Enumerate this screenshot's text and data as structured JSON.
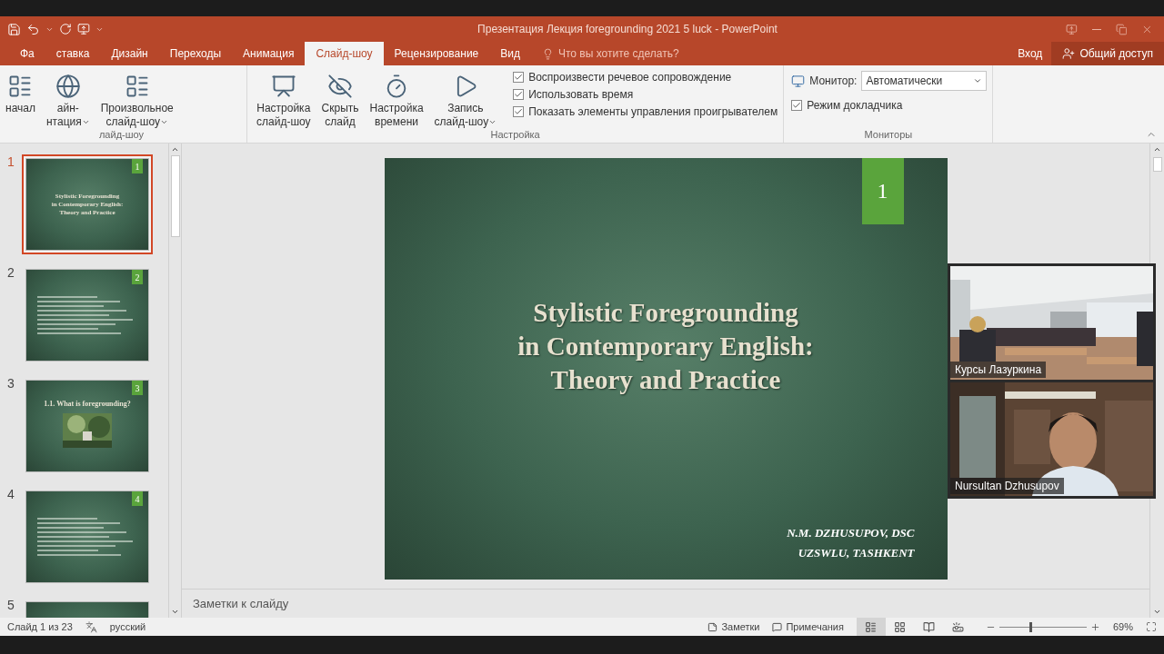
{
  "window": {
    "title": "Презентация  Лекция foregrounding 2021 5 luck - PowerPoint"
  },
  "tabs": [
    {
      "label": "Фа",
      "selected": false
    },
    {
      "label": "ставка",
      "selected": false
    },
    {
      "label": "Дизайн",
      "selected": false
    },
    {
      "label": "Переходы",
      "selected": false
    },
    {
      "label": "Анимация",
      "selected": false
    },
    {
      "label": "Слайд-шоу",
      "selected": true
    },
    {
      "label": "Рецензирование",
      "selected": false
    },
    {
      "label": "Вид",
      "selected": false
    }
  ],
  "tell_me": {
    "placeholder": "Что вы хотите сделать?"
  },
  "account": {
    "sign_in": "Вход",
    "share": "Общий доступ"
  },
  "ribbon_groups": [
    {
      "label": "лайд-шоу",
      "items": [
        {
          "kind": "button",
          "lines": [
            "начал"
          ],
          "dropdown": false
        },
        {
          "kind": "button",
          "lines": [
            "айн-",
            "нтация"
          ],
          "dropdown": true
        },
        {
          "kind": "button",
          "lines": [
            "Произвольное",
            "слайд-шоу"
          ],
          "dropdown": true
        }
      ]
    },
    {
      "label": "Настройка",
      "items": [
        {
          "kind": "button",
          "lines": [
            "Настройка",
            "слайд-шоу"
          ],
          "dropdown": false
        },
        {
          "kind": "button",
          "lines": [
            "Скрыть",
            "слайд"
          ],
          "dropdown": false
        },
        {
          "kind": "button",
          "lines": [
            "Настройка",
            "времени"
          ],
          "dropdown": false
        },
        {
          "kind": "button",
          "lines": [
            "Запись",
            "слайд-шоу"
          ],
          "dropdown": true
        },
        {
          "kind": "checks",
          "options": [
            {
              "label": "Воспроизвести речевое сопровождение",
              "checked": true
            },
            {
              "label": "Использовать время",
              "checked": true
            },
            {
              "label": "Показать элементы управления проигрывателем",
              "checked": true
            }
          ]
        }
      ]
    },
    {
      "label": "Мониторы",
      "items": [
        {
          "kind": "monitor",
          "label": "Монитор:",
          "value": "Автоматически",
          "options": [
            {
              "label": "Режим докладчика",
              "checked": true
            }
          ]
        }
      ]
    }
  ],
  "slides": [
    {
      "number": "1",
      "selected": true,
      "kind": "title",
      "badge": "1",
      "title_lines": [
        "Stylistic Foregrounding",
        "in Contemporary English:",
        "Theory and Practice"
      ]
    },
    {
      "number": "2",
      "selected": false,
      "kind": "bullets",
      "badge": "2"
    },
    {
      "number": "3",
      "selected": false,
      "kind": "picture",
      "badge": "3",
      "title": "1.1. What is foregrounding?"
    },
    {
      "number": "4",
      "selected": false,
      "kind": "bullets",
      "badge": "4"
    },
    {
      "number": "5",
      "selected": false,
      "kind": "cut_off"
    }
  ],
  "current_slide": {
    "badge": "1",
    "title_lines": [
      "Stylistic Foregrounding",
      "in Contemporary English:",
      "Theory and Practice"
    ],
    "author_lines": [
      "N.M. DZHUSUPOV, DSC",
      "UZSWLU, TASHKENT"
    ]
  },
  "notes": {
    "placeholder": "Заметки к слайду"
  },
  "video_call": [
    {
      "name": "Курсы Лазуркина"
    },
    {
      "name": "Nursultan Dzhusupov"
    }
  ],
  "status_bar": {
    "slide": "Слайд 1 из 23",
    "language": "русский",
    "notes": "Заметки",
    "comments": "Примечания",
    "views": [
      {
        "kind": "normal",
        "selected": true
      },
      {
        "kind": "sorter",
        "selected": false
      },
      {
        "kind": "reading",
        "selected": false
      },
      {
        "kind": "show",
        "selected": false
      }
    ],
    "zoom": {
      "level": 0.34,
      "reading": "69%"
    }
  }
}
